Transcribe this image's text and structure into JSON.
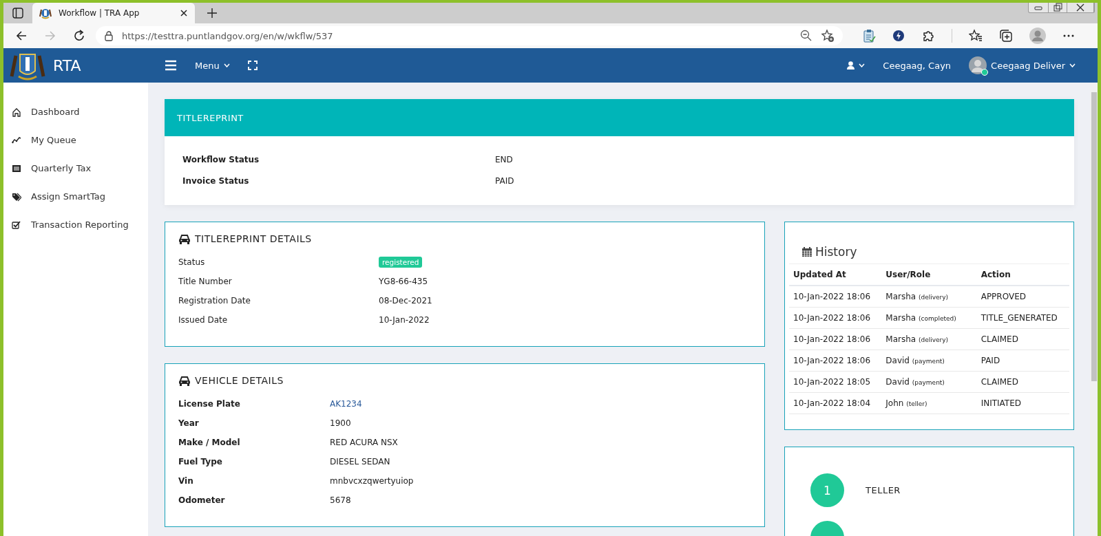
{
  "browser": {
    "tab_title": "Workflow | TRA App",
    "url": "https://testtra.puntlandgov.org/en/w/wkflw/537"
  },
  "header": {
    "brand": "RTA",
    "menu": "Menu",
    "user_short": "Ceegaag, Cayn",
    "user_name": "Ceegaag Deliver",
    "online": true
  },
  "sidebar": {
    "items": [
      {
        "label": "Dashboard"
      },
      {
        "label": "My Queue"
      },
      {
        "label": "Quarterly Tax"
      },
      {
        "label": "Assign SmartTag"
      },
      {
        "label": "Transaction Reporting"
      }
    ]
  },
  "workflow": {
    "title": "TITLEREPRINT",
    "fields": [
      {
        "label": "Workflow Status",
        "value": "END"
      },
      {
        "label": "Invoice Status",
        "value": "PAID"
      }
    ]
  },
  "details": {
    "title": "TITLEREPRINT DETAILS",
    "fields": [
      {
        "label": "Status",
        "value": "registered",
        "kind": "badge"
      },
      {
        "label": "Title Number",
        "value": "YG8-66-435",
        "kind": "text"
      },
      {
        "label": "Registration Date",
        "value": "08-Dec-2021",
        "kind": "text"
      },
      {
        "label": "Issued Date",
        "value": "10-Jan-2022",
        "kind": "text"
      }
    ]
  },
  "vehicle": {
    "title": "VEHICLE DETAILS",
    "fields": [
      {
        "label": "License Plate",
        "value": "AK1234",
        "kind": "link"
      },
      {
        "label": "Year",
        "value": "1900",
        "kind": "text"
      },
      {
        "label": "Make / Model",
        "value": "RED ACURA NSX",
        "kind": "text"
      },
      {
        "label": "Fuel Type",
        "value": "DIESEL SEDAN",
        "kind": "text"
      },
      {
        "label": "Vin",
        "value": "mnbvcxzqwertyuiop",
        "kind": "text"
      },
      {
        "label": "Odometer",
        "value": "5678",
        "kind": "text"
      }
    ]
  },
  "history": {
    "title": "History",
    "columns": [
      "Updated At",
      "User/Role",
      "Action"
    ],
    "rows": [
      {
        "updated_at": "10-Jan-2022 18:06",
        "user": "Marsha",
        "role": "(delivery)",
        "action": "APPROVED"
      },
      {
        "updated_at": "10-Jan-2022 18:06",
        "user": "Marsha",
        "role": "(completed)",
        "action": "TITLE_GENERATED"
      },
      {
        "updated_at": "10-Jan-2022 18:06",
        "user": "Marsha",
        "role": "(delivery)",
        "action": "CLAIMED"
      },
      {
        "updated_at": "10-Jan-2022 18:06",
        "user": "David",
        "role": "(payment)",
        "action": "PAID"
      },
      {
        "updated_at": "10-Jan-2022 18:05",
        "user": "David",
        "role": "(payment)",
        "action": "CLAIMED"
      },
      {
        "updated_at": "10-Jan-2022 18:04",
        "user": "John",
        "role": "(teller)",
        "action": "INITIATED"
      }
    ]
  },
  "steps": [
    {
      "kind": "full",
      "number": "1",
      "label": "TELLER"
    },
    {
      "kind": "cut"
    }
  ]
}
